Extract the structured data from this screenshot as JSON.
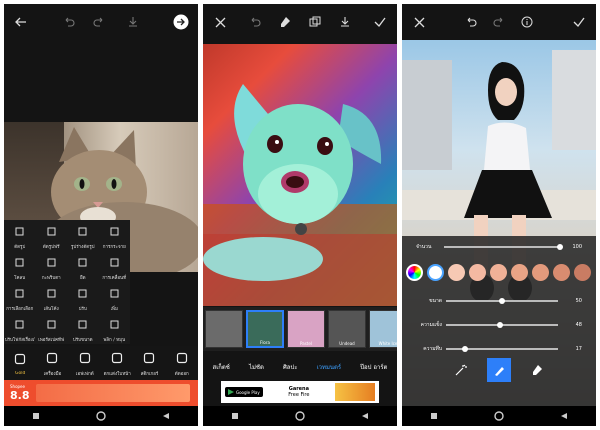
{
  "panel1": {
    "tools": [
      {
        "label": "ตัดรูป",
        "icon": "crop-icon"
      },
      {
        "label": "ตัดรูปฟรี",
        "icon": "free-crop-icon"
      },
      {
        "label": "รูปร่างตัดรูป",
        "icon": "shape-crop-icon"
      },
      {
        "label": "การกระจาย",
        "icon": "dispersion-icon"
      },
      {
        "label": "โคลน",
        "icon": "clone-icon"
      },
      {
        "label": "กะพริบตา",
        "icon": "sparkle-icon"
      },
      {
        "label": "ยืด",
        "icon": "stretch-icon"
      },
      {
        "label": "การเคลื่อนที่",
        "icon": "motion-icon"
      },
      {
        "label": "การเลือกเลือก",
        "icon": "select-icon"
      },
      {
        "label": "เส้นโค้ง",
        "icon": "curves-icon"
      },
      {
        "label": "ปรับ",
        "icon": "adjust-icon"
      },
      {
        "label": "เพิ่ม",
        "icon": "enhance-icon"
      },
      {
        "label": "ปรับโฟกัสเรื่องเรื่อง",
        "icon": "tilt-shift-icon"
      },
      {
        "label": "เพอร์สเปคทีฟ",
        "icon": "perspective-icon"
      },
      {
        "label": "ปรับขนาด",
        "icon": "resize-icon"
      },
      {
        "label": "พลิก / หมุน",
        "icon": "flip-rotate-icon"
      }
    ],
    "bottom_tools": [
      {
        "label": "Gold",
        "icon": "crown-icon"
      },
      {
        "label": "เครื่องมือ",
        "icon": "tools-icon"
      },
      {
        "label": "เอฟเฟกต์",
        "icon": "fx-icon"
      },
      {
        "label": "ตกแต่งใบหน้า",
        "icon": "beautify-icon"
      },
      {
        "label": "สติกเกอร์",
        "icon": "sticker-icon"
      },
      {
        "label": "ตัดออก",
        "icon": "cutout-icon"
      }
    ],
    "banner_brand": "Shopee",
    "banner_text": "8.8"
  },
  "panel2": {
    "filters": [
      {
        "name": ""
      },
      {
        "name": "Flora",
        "selected": true
      },
      {
        "name": "Pastel"
      },
      {
        "name": "Undead"
      },
      {
        "name": "White Ice"
      }
    ],
    "categories": [
      {
        "label": "สเก็ตช์",
        "active": false
      },
      {
        "label": "ไม่ชัด",
        "active": false
      },
      {
        "label": "ศิลปะ",
        "active": false
      },
      {
        "label": "เวทมนตร์",
        "active": true
      },
      {
        "label": "ป๊อป อาร์ต",
        "active": false
      }
    ],
    "ad": {
      "store": "Google Play",
      "title": "Garena",
      "subtitle": "Free Fire"
    }
  },
  "panel3": {
    "amount_label": "จำนวน",
    "amount_value": "100",
    "amount_fraction": 1.0,
    "swatches": [
      "#ffffff",
      "#f7c9b4",
      "#f4b9a2",
      "#f0b197",
      "#e9a486",
      "#e39a7c",
      "#d98c70",
      "#c97c63"
    ],
    "sliders": [
      {
        "label": "ขนาด",
        "value": "50",
        "fraction": 0.5
      },
      {
        "label": "ความแข็ง",
        "value": "48",
        "fraction": 0.48
      },
      {
        "label": "ความทึบ",
        "value": "17",
        "fraction": 0.17
      }
    ]
  }
}
